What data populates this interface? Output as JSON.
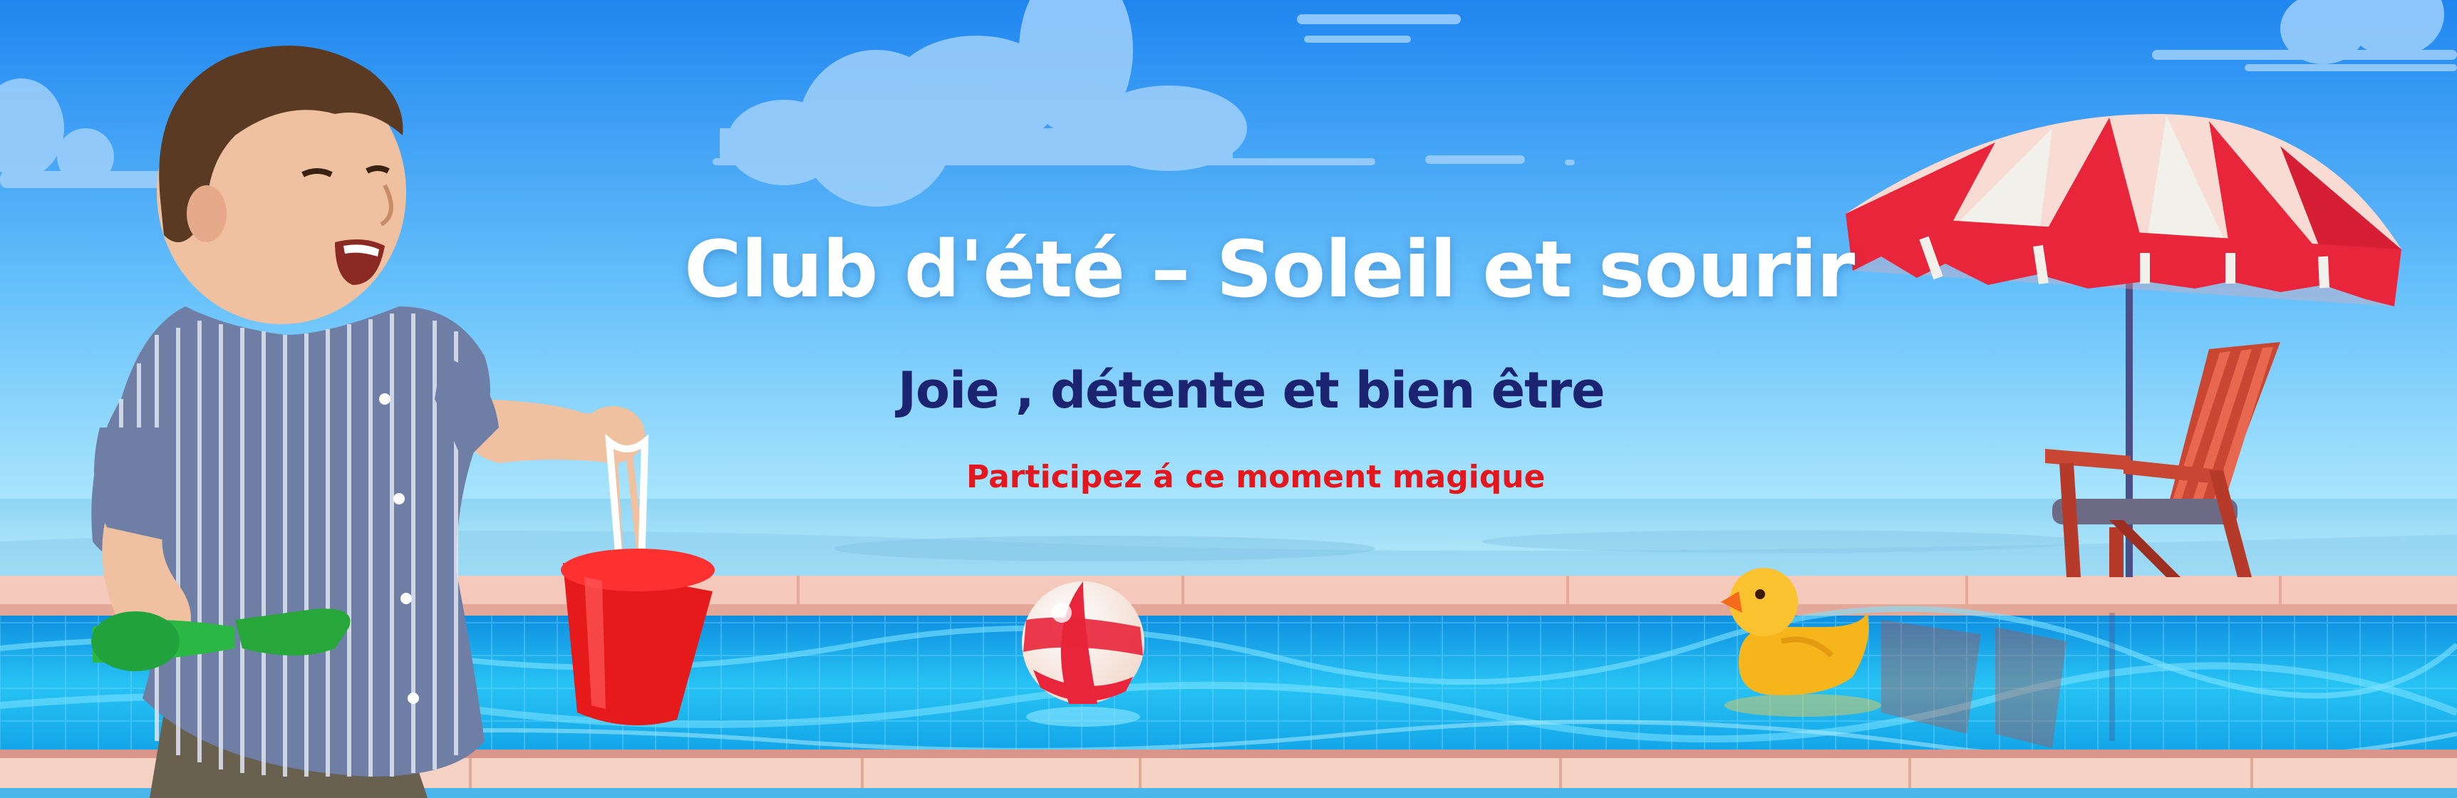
{
  "banner": {
    "title": "Club d'été – Soleil et sourir",
    "subtitle": "Joie , détente et bien être",
    "cta": "Participez á ce moment magique"
  },
  "colors": {
    "sky_top": "#1f86f0",
    "sky_bottom": "#a8e6fb",
    "water": "#20b8f0",
    "water_light": "#5fd9ff",
    "pool_edge": "#f2c6b8",
    "title": "#ffffff",
    "subtitle": "#1c2370",
    "cta": "#e3171d",
    "umbrella_red": "#e8253a",
    "duck": "#f7b51c"
  }
}
